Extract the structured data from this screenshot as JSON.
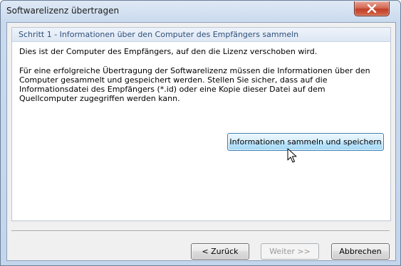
{
  "window": {
    "title": "Softwarelizenz übertragen"
  },
  "step": {
    "title": "Schritt 1 - Informationen über den Computer des Empfängers sammeln"
  },
  "content": {
    "line1": "Dies ist der Computer des Empfängers, auf den die Lizenz verschoben wird.",
    "para_line1": "Für eine erfolgreiche Übertragung der Softwarelizenz müssen die Informationen über den",
    "para_line2": "Computer gesammelt und gespeichert werden. Stellen Sie sicher, dass auf die",
    "para_line3": "Informationsdatei des Empfängers (*.id) oder eine Kopie dieser Datei auf dem",
    "para_line4": "Quellcomputer zugegriffen werden kann."
  },
  "buttons": {
    "collect_save": "Informationen sammeln und speichern",
    "back": "< Zurück",
    "next": "Weiter >>",
    "cancel": "Abbrechen"
  },
  "icons": {
    "close": "close-icon",
    "cursor": "mouse-cursor-icon"
  },
  "colors": {
    "close_button": "#c13f28",
    "step_title": "#2f4f7a",
    "highlight_button_border": "#3c7fb1"
  }
}
